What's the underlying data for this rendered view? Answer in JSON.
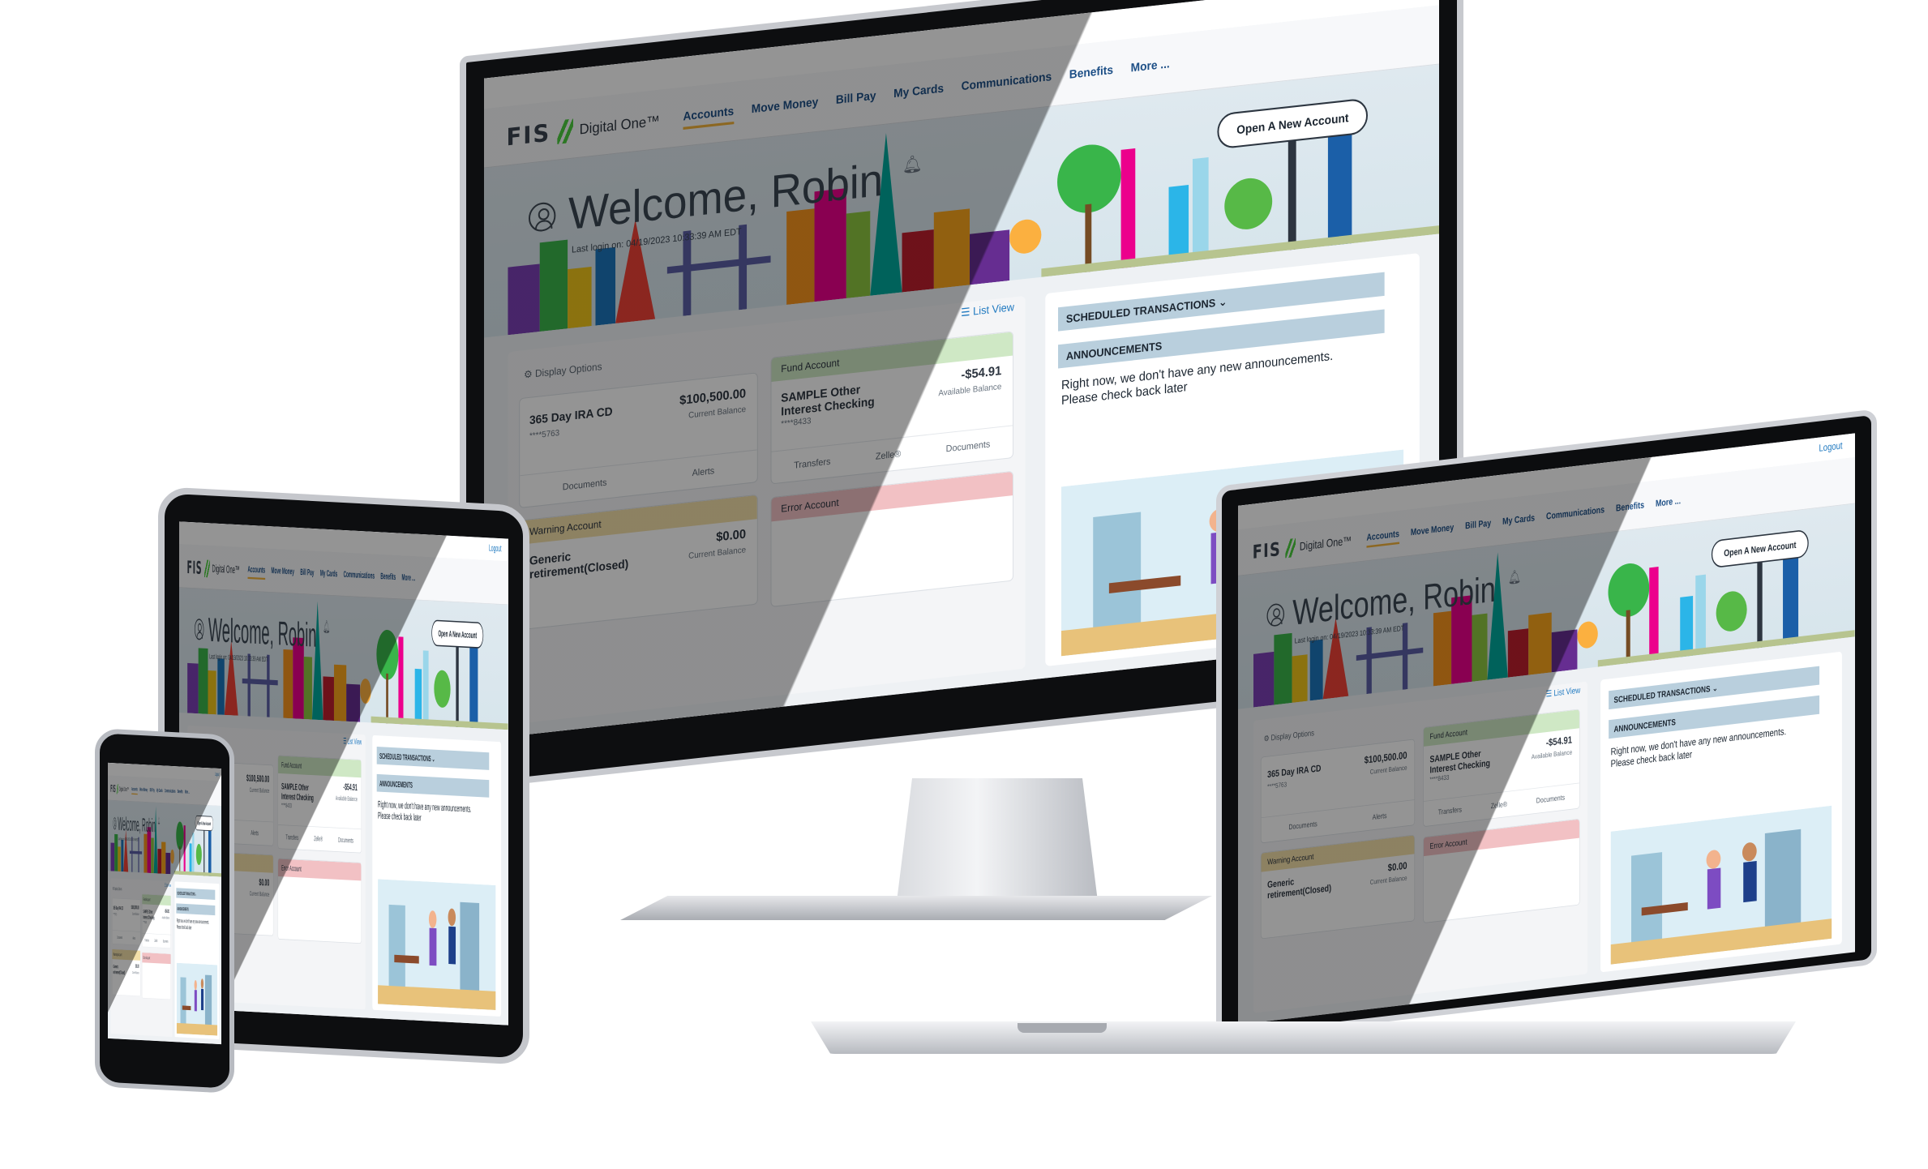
{
  "app": {
    "logout_label": "Logout",
    "brand": {
      "logo_text": "FIS",
      "product_name": "Digital One™"
    },
    "nav": [
      {
        "label": "Accounts",
        "active": true
      },
      {
        "label": "Move Money"
      },
      {
        "label": "Bill Pay"
      },
      {
        "label": "My Cards"
      },
      {
        "label": "Communications"
      },
      {
        "label": "Benefits"
      },
      {
        "label": "More ..."
      }
    ],
    "welcome": {
      "greeting": "Welcome, Robin",
      "last_login": "Last login on: 04/19/2023 10:33:39 AM EDT"
    },
    "open_account_label": "Open A New Account",
    "display_options_label": "Display Options",
    "list_view_label": "List View",
    "accounts": [
      {
        "name": "365 Day IRA CD",
        "mask": "****5763",
        "amount": "$100,500.00",
        "balance_label": "Current Balance",
        "actions": [
          "Documents",
          "Alerts"
        ]
      },
      {
        "header": "Fund Account",
        "name": "SAMPLE Other Interest Checking",
        "mask": "****8433",
        "amount": "-$54.91",
        "balance_label": "Available Balance",
        "actions": [
          "Transfers",
          "Zelle®",
          "Documents"
        ]
      },
      {
        "header": "Warning Account",
        "name": "Generic retirement(Closed)",
        "amount": "$0.00",
        "balance_label": "Current Balance"
      },
      {
        "header": "Error Account"
      }
    ],
    "scheduled_transactions_label": "SCHEDULED TRANSACTIONS",
    "announcements_label": "ANNOUNCEMENTS",
    "announcements_text": "Right now, we don't have any new announcements. Please check back later"
  },
  "colors": {
    "nav_text": "#1d4f86",
    "active_underline": "#f2b23a",
    "brand_green": "#4bcd3e",
    "fund_green": "#cfe8c5",
    "warning_yellow": "#f3dfa8",
    "error_red": "#f2c1c4",
    "info_teal": "#c8dbe3",
    "section_blue": "#b9cfdd"
  }
}
